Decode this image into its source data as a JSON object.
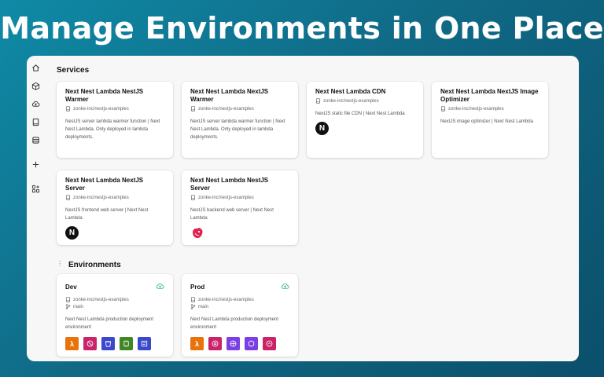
{
  "headline": "Manage Environments in One Place",
  "services_title": "Services",
  "environments_title": "Environments",
  "services": [
    {
      "title": "Next Nest Lambda NestJS Warmer",
      "repo": "zonke-inc/nestjs-examples",
      "desc": "NestJS server lambda warmer function | Next Nest Lambda. Only deployed in lambda deployments.",
      "badge": ""
    },
    {
      "title": "Next Nest Lambda NextJS Warmer",
      "repo": "zonke-inc/nestjs-examples",
      "desc": "NextJS server lambda warmer function | Next Nest Lambda. Only deployed in lambda deployments.",
      "badge": ""
    },
    {
      "title": "Next Nest Lambda CDN",
      "repo": "zonke-inc/nestjs-examples",
      "desc": "NextJS static file CDN | Next Nest Lambda",
      "badge": "N"
    },
    {
      "title": "Next Nest Lambda NextJS Image Optimizer",
      "repo": "zonke-inc/nestjs-examples",
      "desc": "NextJS image optimizer | Next Nest Lambda",
      "badge": ""
    },
    {
      "title": "Next Nest Lambda NextJS Server",
      "repo": "zonke-inc/nestjs-examples",
      "desc": "NextJS frontend web server | Next Nest Lambda",
      "badge": "N"
    },
    {
      "title": "Next Nest Lambda NestJS Server",
      "repo": "zonke-inc/nestjs-examples",
      "desc": "NestJS backend web server | Next Nest Lambda",
      "badge": "nest"
    }
  ],
  "environments": [
    {
      "name": "Dev",
      "repo": "zonke-inc/nestjs-examples",
      "branch": "main",
      "desc": "Next Nest Lambda production deployment environment",
      "services": [
        "lambda-icon",
        "rds-icon",
        "s3-icon",
        "ec2-icon",
        "cloudformation-icon"
      ]
    },
    {
      "name": "Prod",
      "repo": "zonke-inc/nestjs-examples",
      "branch": "main",
      "desc": "Next Nest Lambda production deployment environment",
      "services": [
        "lambda-icon",
        "rds-icon",
        "vpc-icon",
        "ecs-icon",
        "cloudwatch-icon"
      ]
    }
  ],
  "colors": {
    "lambda": "#e8720c",
    "rds": "#c9246a",
    "s3": "#3b48cc",
    "ec2": "#3f8624",
    "cloudformation": "#3b48cc",
    "purple": "#7b3fe4",
    "cloud_green": "#3fb98a"
  }
}
